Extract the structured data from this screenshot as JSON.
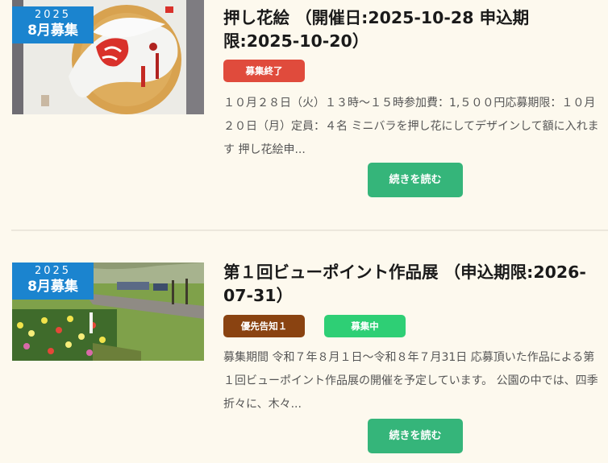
{
  "posts": [
    {
      "badge_year": "2025",
      "badge_month": "8月募集",
      "title": "押し花絵 （開催日:2025-10-28 申込期限:2025-10-20）",
      "tags": [
        "募集終了"
      ],
      "excerpt": "１０月２８日（火）１３時〜１５時参加費：1,５００円応募期限：１０月２０日（月）定員：４名 ミニバラを押し花にしてデザインして額に入れます 押し花絵申...",
      "more_label": "続きを読む"
    },
    {
      "badge_year": "2025",
      "badge_month": "8月募集",
      "title": "第１回ビューポイント作品展 （申込期限:2026-07-31）",
      "tags": [
        "優先告知１",
        "募集中"
      ],
      "excerpt": "募集期間 令和７年８月１日〜令和８年７月31日 応募頂いた作品による第１回ビューポイント作品展の開催を予定しています。 公園の中では、四季折々に、木々...",
      "more_label": "続きを読む"
    }
  ],
  "colors": {
    "badge": "#1b84cf",
    "tag_closed": "#e04b3c",
    "tag_priority": "#8a4311",
    "tag_open": "#2ecf75",
    "read_more": "#35b57a",
    "background": "#fdf9ee"
  }
}
